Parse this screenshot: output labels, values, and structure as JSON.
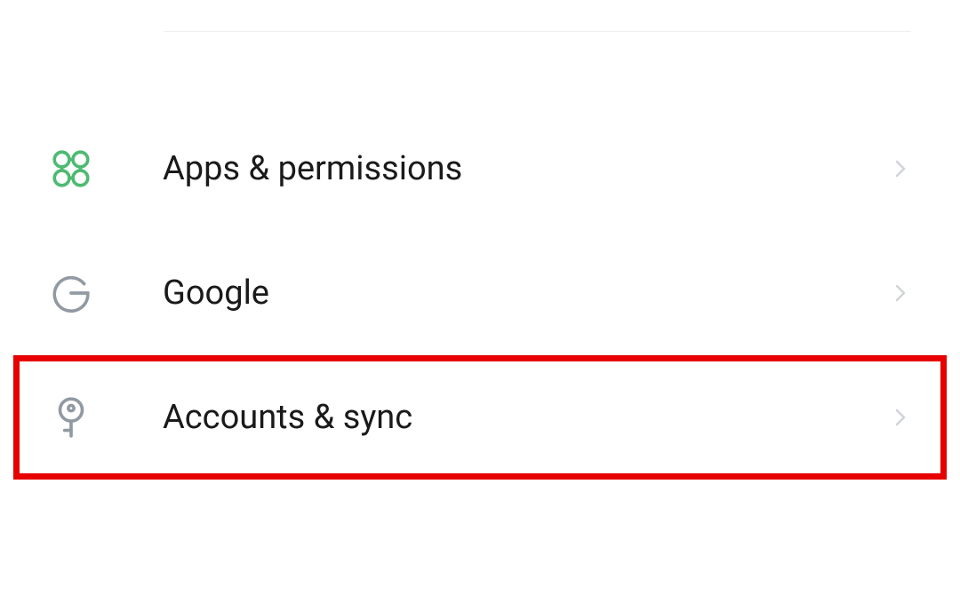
{
  "settings": {
    "items": [
      {
        "label": "Apps & permissions",
        "icon": "apps-permissions",
        "highlighted": false
      },
      {
        "label": "Google",
        "icon": "google",
        "highlighted": false
      },
      {
        "label": "Accounts & sync",
        "icon": "key",
        "highlighted": true
      }
    ]
  },
  "colors": {
    "accent_green": "#4eba73",
    "icon_gray": "#9199a3",
    "chevron_gray": "#d0d4d9",
    "highlight_red": "#e60000",
    "text": "#1a1a1a"
  }
}
